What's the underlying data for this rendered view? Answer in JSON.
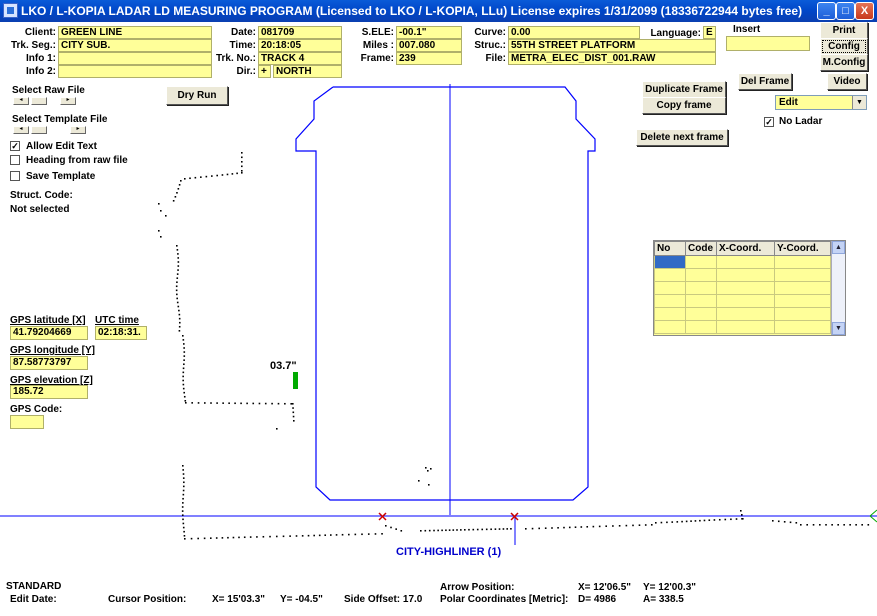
{
  "window": {
    "title": "LKO / L-KOPIA LADAR LD MEASURING PROGRAM    (Licensed to LKO / L-KOPIA, LLu)    License expires 1/31/2099    (18336722944 bytes free)",
    "minimize": "_",
    "maximize": "□",
    "close": "X"
  },
  "header": {
    "client_label": "Client:",
    "client": "GREEN LINE",
    "trk_seg_label": "Trk. Seg.:",
    "trk_seg": "CITY SUB.",
    "info1_label": "Info 1:",
    "info1": "",
    "info2_label": "Info 2:",
    "info2": "",
    "date_label": "Date:",
    "date": "081709",
    "time_label": "Time:",
    "time": "20:18:05",
    "trk_no_label": "Trk. No.:",
    "trk_no": "TRACK 4",
    "dir_label": "Dir.:",
    "dir_sign": "+",
    "dir": "NORTH",
    "sele_label": "S.ELE:",
    "sele": "-00.1\"",
    "miles_label": "Miles :",
    "miles": "007.080",
    "frame_label": "Frame:",
    "frame": "239",
    "curve_label": "Curve:",
    "curve": "0.00",
    "struc_label": "Struc.:",
    "struc": "55TH STREET PLATFORM",
    "file_label": "File:",
    "file": "METRA_ELEC_DIST_001.RAW",
    "language_label": "Language:",
    "language": "E",
    "insert_label": "Insert",
    "insert_value": ""
  },
  "buttons": {
    "print": "Print",
    "config": "Config",
    "mconfig": "M.Config",
    "del_frame": "Del Frame",
    "video": "Video",
    "duplicate_frame": "Duplicate Frame",
    "copy_frame": "Copy frame",
    "delete_next_frame": "Delete next frame",
    "dry_run": "Dry Run"
  },
  "mode_select": {
    "value": "Edit"
  },
  "no_ladar": {
    "label": "No Ladar",
    "checked": true
  },
  "left_panel": {
    "select_raw_file": "Select Raw File",
    "select_template_file": "Select Template File",
    "allow_edit_text": "Allow Edit Text",
    "heading_from_raw": "Heading from raw file",
    "save_template": "Save Template",
    "struct_code_label": "Struct. Code:",
    "struct_code_value": "Not selected",
    "gps_lat_label": "GPS latitude [X]",
    "gps_lat": "41.79204669",
    "utc_label": "UTC time",
    "utc": "02:18:31.",
    "gps_lon_label": "GPS longitude [Y]",
    "gps_lon": "87.58773797",
    "gps_elev_label": "GPS elevation [Z]",
    "gps_elev": "185.72",
    "gps_code_label": "GPS Code:",
    "gps_code": ""
  },
  "coords_grid": {
    "columns": [
      "No",
      "Code",
      "X-Coord.",
      "Y-Coord."
    ],
    "rows": [
      [
        "",
        "",
        "",
        ""
      ],
      [
        "",
        "",
        "",
        ""
      ],
      [
        "",
        "",
        "",
        ""
      ],
      [
        "",
        "",
        "",
        ""
      ],
      [
        "",
        "",
        "",
        ""
      ],
      [
        "",
        "",
        "",
        ""
      ]
    ]
  },
  "canvas": {
    "marker_label": "03.7\"",
    "vehicle_label": "CITY-HIGHLINER  (1)",
    "outline_color": "#0000ff",
    "marker_color": "#00aa00"
  },
  "status_bar": {
    "mode": "STANDARD",
    "edit_date_label": "Edit Date:",
    "cursor_label": "Cursor Position:",
    "cursor_x": "X=  15'03.3\"",
    "cursor_y": "Y=  -04.5\"",
    "side_offset": "Side Offset:  17.0",
    "arrow_label": "Arrow Position:",
    "arrow_x": "X= 12'06.5\"",
    "arrow_y": "Y= 12'00.3\"",
    "polar_label": "Polar Coordinates [Metric]:",
    "polar_d": "D=  4986",
    "polar_a": "A=  338.5"
  }
}
